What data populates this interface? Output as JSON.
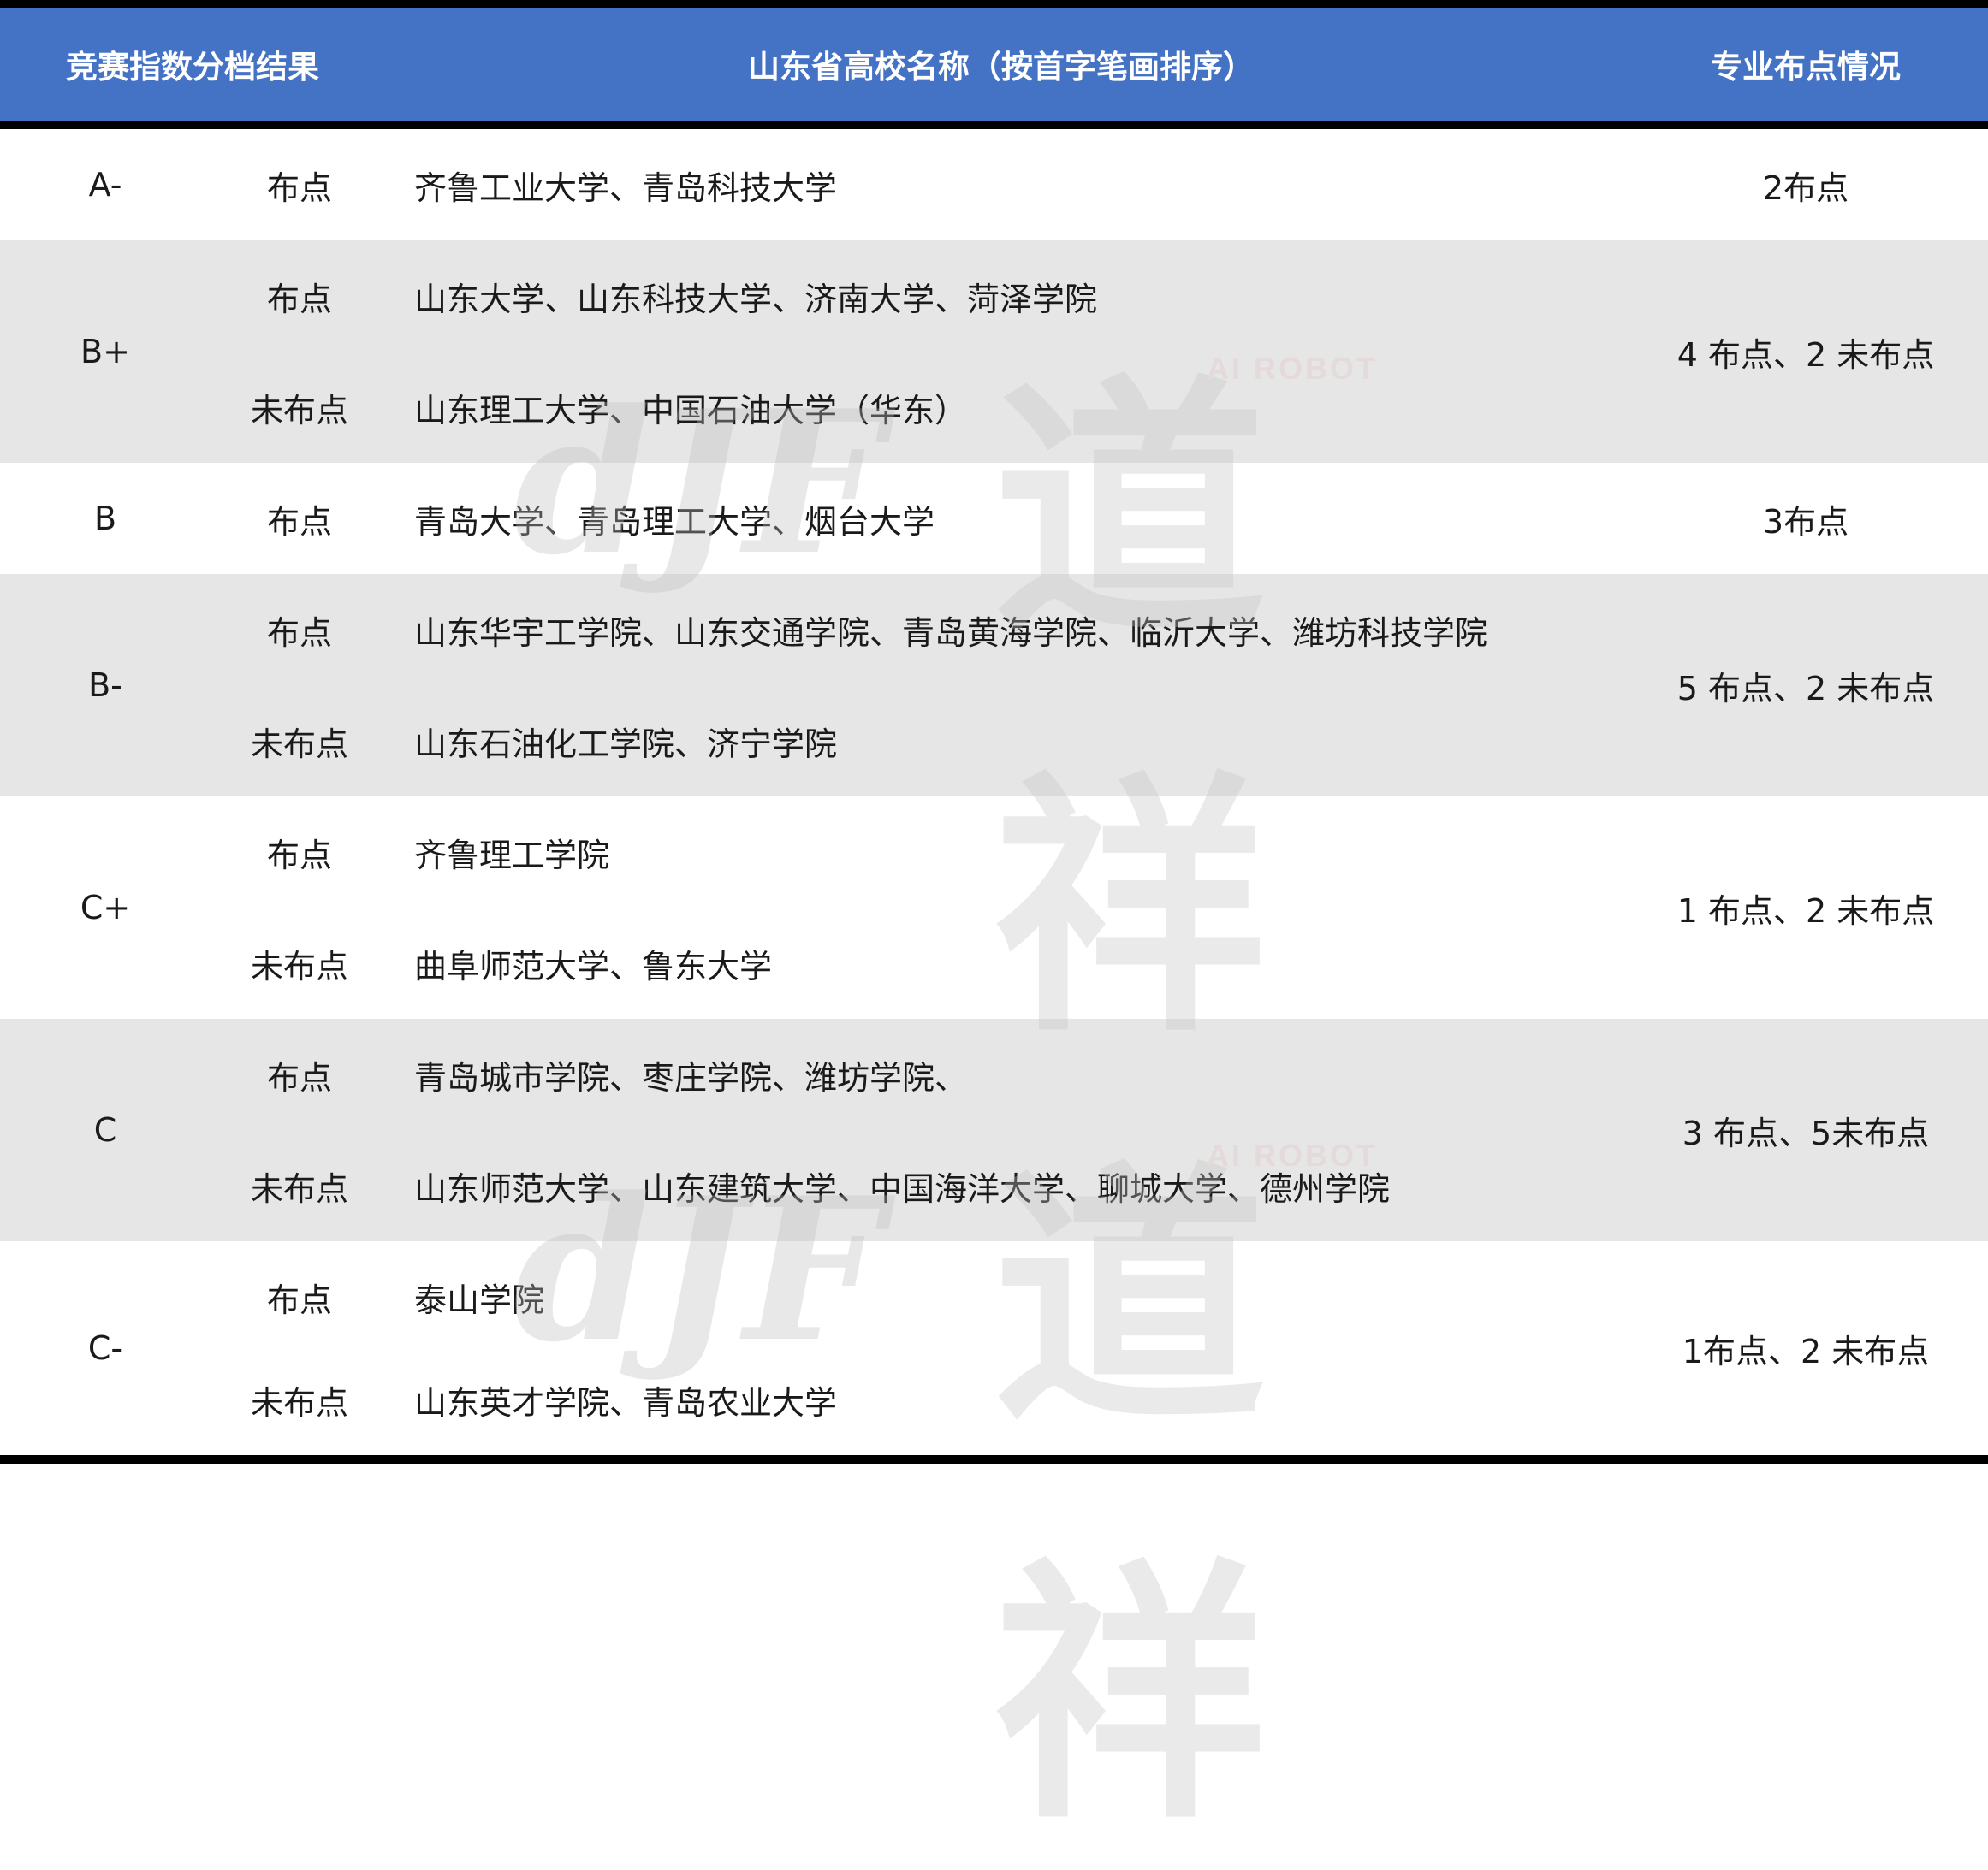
{
  "header": {
    "grade": "竞赛指数分档结果",
    "names": "山东省高校名称（按首字笔画排序）",
    "status": "专业布点情况"
  },
  "rows": [
    {
      "grade": "A-",
      "status": "2布点",
      "lines": [
        {
          "type": "布点",
          "names": "齐鲁工业大学、青岛科技大学"
        }
      ]
    },
    {
      "grade": "B+",
      "status": "4 布点、2 未布点",
      "lines": [
        {
          "type": "布点",
          "names": "山东大学、山东科技大学、济南大学、菏泽学院"
        },
        {
          "type": "未布点",
          "names": "山东理工大学、中国石油大学（华东）"
        }
      ]
    },
    {
      "grade": "B",
      "status": "3布点",
      "lines": [
        {
          "type": "布点",
          "names": "青岛大学、青岛理工大学、烟台大学"
        }
      ]
    },
    {
      "grade": "B-",
      "status": "5 布点、2 未布点",
      "lines": [
        {
          "type": "布点",
          "names": "山东华宇工学院、山东交通学院、青岛黄海学院、临沂大学、潍坊科技学院"
        },
        {
          "type": "未布点",
          "names": "山东石油化工学院、济宁学院"
        }
      ]
    },
    {
      "grade": "C+",
      "status": "1 布点、2 未布点",
      "lines": [
        {
          "type": "布点",
          "names": "齐鲁理工学院"
        },
        {
          "type": "未布点",
          "names": "曲阜师范大学、鲁东大学"
        }
      ]
    },
    {
      "grade": "C",
      "status": "3 布点、5未布点",
      "lines": [
        {
          "type": "布点",
          "names": "青岛城市学院、枣庄学院、潍坊学院、"
        },
        {
          "type": "未布点",
          "names": "山东师范大学、山东建筑大学、中国海洋大学、聊城大学、德州学院"
        }
      ]
    },
    {
      "grade": "C-",
      "status": "1布点、2 未布点",
      "lines": [
        {
          "type": "布点",
          "names": "泰山学院"
        },
        {
          "type": "未布点",
          "names": "山东英才学院、青岛农业大学"
        }
      ]
    }
  ],
  "watermark": {
    "logo_text": "dJF",
    "cn_text": "道祥",
    "sub_text": "AI ROBOT"
  }
}
